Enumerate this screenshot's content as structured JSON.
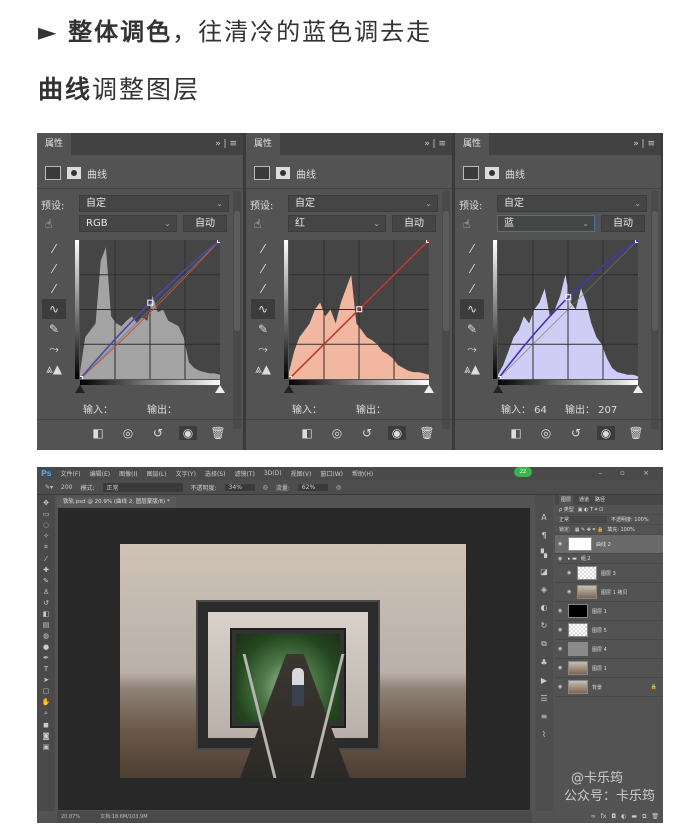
{
  "heading1": {
    "bullet": "►",
    "bold": "整体调色",
    "rest": "，往清冷的蓝色调去走"
  },
  "heading2": {
    "bold": "曲线",
    "rest": "调整图层"
  },
  "curves_panels": [
    {
      "tab": "属性",
      "tab_controls": "» | ≡",
      "type_label": "曲线",
      "preset_label": "预设:",
      "preset_value": "自定",
      "channel": "RGB",
      "auto_label": "自动",
      "input_label": "输入：",
      "input_value": "",
      "output_label": "输出：",
      "output_value": "",
      "hist_color": "#a3a3a3",
      "curve_color": "#4a4aa8",
      "curve_points": [
        [
          0,
          0
        ],
        [
          128,
          140
        ],
        [
          255,
          255
        ]
      ],
      "extra_lines": [
        {
          "color": "#c0504d",
          "points": [
            [
              0,
              0
            ],
            [
              128,
              122
            ],
            [
              255,
              255
            ]
          ]
        }
      ],
      "histogram": [
        0.05,
        0.3,
        0.35,
        0.4,
        0.85,
        0.95,
        0.45,
        0.4,
        0.38,
        0.42,
        0.45,
        0.4,
        0.44,
        0.42,
        0.6,
        0.48,
        0.5,
        0.42,
        0.4,
        0.38,
        0.3,
        0.12,
        0.08,
        0.06,
        0.05,
        0.04,
        0.04,
        0.03
      ]
    },
    {
      "tab": "属性",
      "tab_controls": "» | ≡",
      "type_label": "曲线",
      "preset_label": "预设:",
      "preset_value": "自定",
      "channel": "红",
      "auto_label": "自动",
      "input_label": "输入：",
      "input_value": "",
      "output_label": "输出：",
      "output_value": "",
      "hist_color": "#f2b7a0",
      "curve_color": "#c0392b",
      "curve_points": [
        [
          0,
          0
        ],
        [
          128,
          128
        ],
        [
          255,
          255
        ]
      ],
      "extra_lines": [],
      "histogram": [
        0.05,
        0.2,
        0.3,
        0.35,
        0.4,
        0.5,
        0.55,
        0.45,
        0.5,
        0.4,
        0.55,
        0.65,
        0.75,
        0.4,
        0.35,
        0.3,
        0.28,
        0.25,
        0.2,
        0.18,
        0.15,
        0.1,
        0.08,
        0.06,
        0.05,
        0.05,
        0.04,
        0.03
      ]
    },
    {
      "tab": "属性",
      "tab_controls": "» | ≡",
      "type_label": "曲线",
      "preset_label": "预设:",
      "preset_value": "自定",
      "channel": "蓝",
      "auto_label": "自动",
      "input_label": "输入：",
      "input_value": "64",
      "output_label": "输出：",
      "output_value": "207",
      "hist_color": "#cfcdf5",
      "curve_color": "#3a3ab8",
      "curve_points": [
        [
          0,
          0
        ],
        [
          128,
          150
        ],
        [
          255,
          255
        ]
      ],
      "extra_lines": [],
      "histogram": [
        0.03,
        0.1,
        0.2,
        0.3,
        0.35,
        0.45,
        0.4,
        0.5,
        0.55,
        0.65,
        0.45,
        0.5,
        0.6,
        0.75,
        0.55,
        0.5,
        0.65,
        0.55,
        0.4,
        0.3,
        0.25,
        0.15,
        0.08,
        0.05,
        0.04,
        0.03,
        0.03,
        0.02
      ]
    }
  ],
  "photoshop": {
    "logo": "Ps",
    "menu": [
      "文件(F)",
      "编辑(E)",
      "图像(I)",
      "图层(L)",
      "文字(Y)",
      "选择(S)",
      "滤镜(T)",
      "3D(D)",
      "视图(V)",
      "窗口(W)",
      "帮助(H)"
    ],
    "window_controls": "– ▫ ×",
    "badge": "22",
    "options": {
      "brush_size": "200",
      "mode_label": "模式:",
      "mode_value": "正常",
      "opacity_label": "不透明度:",
      "opacity_value": "34%",
      "flow_label": "流量:",
      "flow_value": "62%"
    },
    "doc_tab": "铁轨.psd @ 20.9% (曲线 2, 图层蒙版/8) *",
    "status": {
      "zoom": "20.87%",
      "doc": "文档:18.6M/103.9M"
    },
    "layers_panel": {
      "tabs": [
        "图层",
        "通道",
        "路径"
      ],
      "filter": "ρ 类型",
      "blend": "正常",
      "opacity": "不透明度: 100%",
      "lock": "锁定:",
      "fill": "填充: 100%",
      "layers": [
        {
          "name": "曲线 2",
          "selected": true
        },
        {
          "name": "组 2",
          "group": true
        },
        {
          "name": "图层 3"
        },
        {
          "name": "图层 1 拷贝"
        },
        {
          "name": "图层 1"
        },
        {
          "name": "图层 5"
        },
        {
          "name": "图层 4"
        },
        {
          "name": "图层 1"
        },
        {
          "name": "背景",
          "locked": true
        }
      ]
    },
    "watermark": [
      "@卡乐筠",
      "公众号：卡乐筠"
    ]
  }
}
